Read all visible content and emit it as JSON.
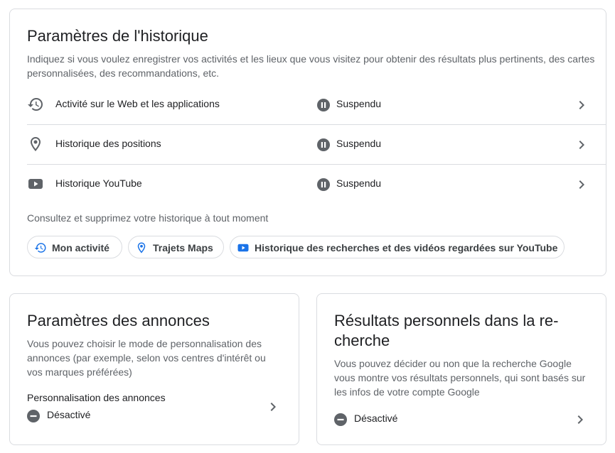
{
  "history": {
    "title": "Paramètres de l'historique",
    "description": "Indiquez si vous voulez enregistrer vos activités et les lieux que vous visitez pour obtenir des résultats plus pertinents, des cartes personnalisées, des recommandations, etc.",
    "rows": [
      {
        "label": "Activité sur le Web et les applications",
        "status": "Suspendu",
        "icon": "history-icon"
      },
      {
        "label": "Historique des positions",
        "status": "Suspendu",
        "icon": "location-pin-icon"
      },
      {
        "label": "Historique YouTube",
        "status": "Suspendu",
        "icon": "youtube-icon"
      }
    ],
    "manage_text": "Consultez et supprimez votre historique à tout moment",
    "chips": [
      {
        "label": "Mon activité",
        "icon": "history-icon"
      },
      {
        "label": "Trajets Maps",
        "icon": "location-pin-icon"
      },
      {
        "label": "Historique des recherches et des vidéos regardées sur YouTube",
        "icon": "youtube-icon"
      }
    ]
  },
  "ads": {
    "title": "Paramètres des annonces",
    "description": "Vous pouvez choisir le mode de personnalisation des annonces (par exemple, selon vos centres d'intérêt ou vos marques préférées)",
    "setting_label": "Personnalisation des annonces",
    "status": "Désactivé"
  },
  "search": {
    "title": "Résultats personnels dans la re­cherche",
    "description": "Vous pouvez décider ou non que la recherche Google vous montre vos résultats personnels, qui sont basés sur les infos de votre compte Google",
    "status": "Désactivé"
  },
  "colors": {
    "text_primary": "#202124",
    "text_secondary": "#5f6368",
    "border": "#dadce0",
    "icon_grey": "#5f6368",
    "chip_blue": "#1a73e8"
  }
}
